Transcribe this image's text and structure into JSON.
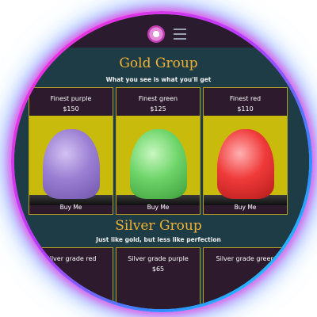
{
  "groups": [
    {
      "title": "Gold Group",
      "subtitle": "What you see is what you'll get",
      "items": [
        {
          "name": "Finest purple",
          "price": "$150",
          "button": "Buy Me"
        },
        {
          "name": "Finest green",
          "price": "$125",
          "button": "Buy Me"
        },
        {
          "name": "Finest red",
          "price": "$110",
          "button": "Buy Me"
        }
      ]
    },
    {
      "title": "Silver Group",
      "subtitle": "Just like gold, but less like perfection",
      "items": [
        {
          "name": "Silver grade red",
          "price": ""
        },
        {
          "name": "Silver grade purple",
          "price": "$65"
        },
        {
          "name": "Silver grade green",
          "price": ""
        }
      ]
    }
  ],
  "colors": {
    "title": "#f2b233",
    "card_bg": "#2d1a2d",
    "card_border": "#b59d1e",
    "image_bg": "#c9bb0b",
    "section_bg": "#1e3c46",
    "purple_gum": "#9b7fd3",
    "green_gum": "#6ed56a",
    "red_gum": "#f03a3a"
  },
  "icons": [
    "logo-icon",
    "hamburger-menu-icon"
  ]
}
